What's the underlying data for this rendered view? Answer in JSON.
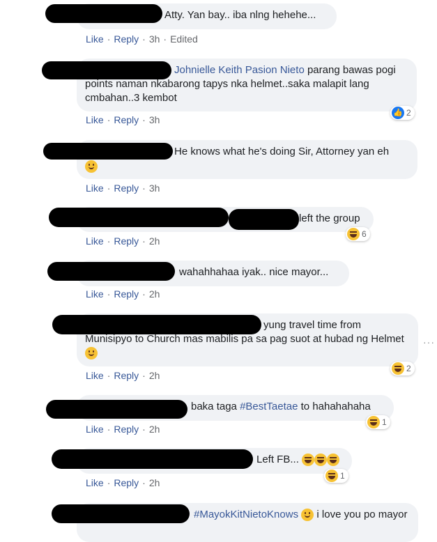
{
  "comments": [
    {
      "text": "Atty. Yan bay.. iba nlng hehehe...",
      "time": "3h",
      "edited": "Edited"
    },
    {
      "mention": "Johnielle Keith Pasion Nieto",
      "text": " parang bawas pogi points naman nkabarong tapys nka helmet..saka malapit lang cmbahan..3 kembot",
      "time": "3h",
      "reaction_count": "2",
      "reaction_icon": "like-icon"
    },
    {
      "text": "He knows what he's doing Sir, Attorney yan eh",
      "time": "3h",
      "emoji": "smile-icon"
    },
    {
      "text": "left the group",
      "time": "2h",
      "reaction_count": "6",
      "reaction_icon": "haha-icon"
    },
    {
      "text": "wahahhahaa iyak.. nice mayor...",
      "time": "2h"
    },
    {
      "text": "yung travel time from Munisipyo to Church mas mabilis pa sa pag suot at hubad ng Helmet",
      "time": "2h",
      "reaction_count": "2",
      "reaction_icon": "haha-icon"
    },
    {
      "text_pre": "baka taga ",
      "hashtag": "#BestTaetae",
      "text_post": " to hahahahaha",
      "time": "2h",
      "reaction_count": "1",
      "reaction_icon": "haha-icon"
    },
    {
      "text": "Left FB...",
      "time": "2h",
      "reaction_count": "1",
      "reaction_icon": "haha-icon"
    },
    {
      "hashtag": "#MayokKitNietoKnows",
      "text_post": " i love you po mayor"
    }
  ],
  "actions": {
    "like": "Like",
    "reply": "Reply",
    "sep": "·"
  },
  "more_options": "···",
  "colors": {
    "link": "#385898",
    "bubble": "#f0f2f5",
    "meta": "#65676b",
    "like_badge": "#1877f2",
    "emoji": "#f7c234"
  }
}
